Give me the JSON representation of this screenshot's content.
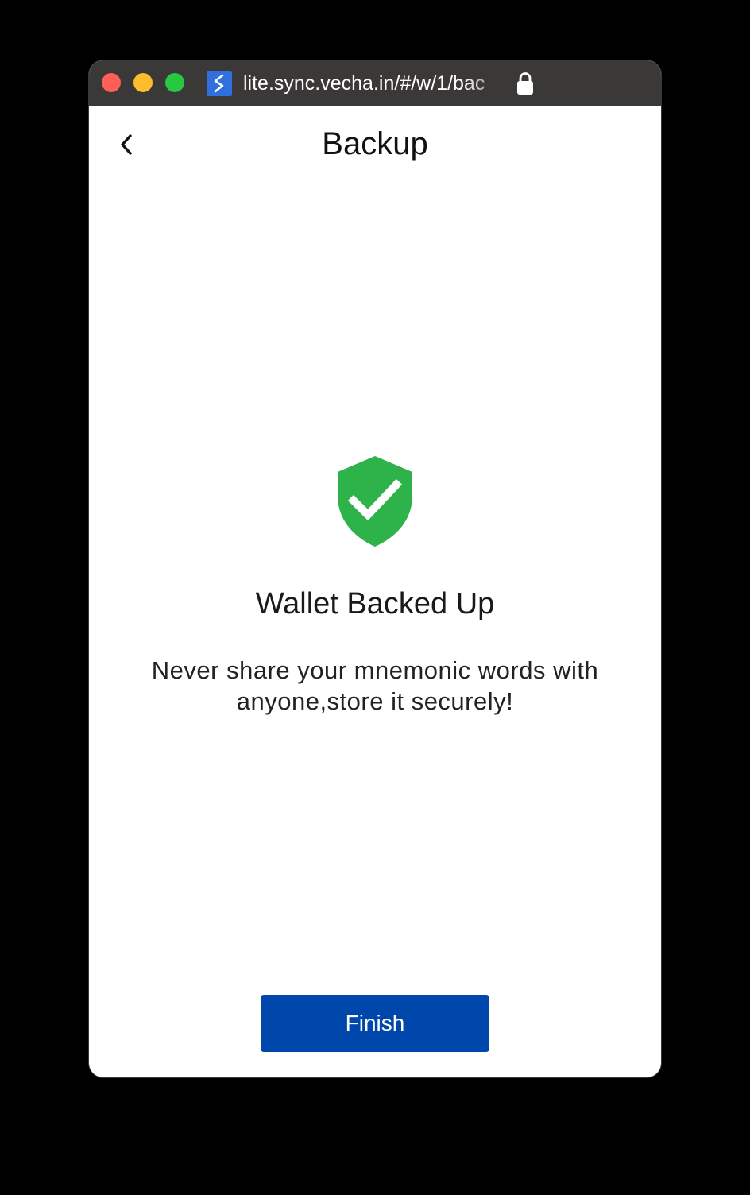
{
  "browser": {
    "url": "lite.sync.vecha.in/#/w/1/bac"
  },
  "header": {
    "title": "Backup",
    "back_icon": "chevron-left-icon"
  },
  "status": {
    "icon": "shield-check-icon",
    "icon_color": "#2db34a",
    "heading": "Wallet Backed Up",
    "message": "Never share your mnemonic words with anyone,store it securely!"
  },
  "actions": {
    "finish_label": "Finish",
    "finish_color": "#0047ab"
  }
}
